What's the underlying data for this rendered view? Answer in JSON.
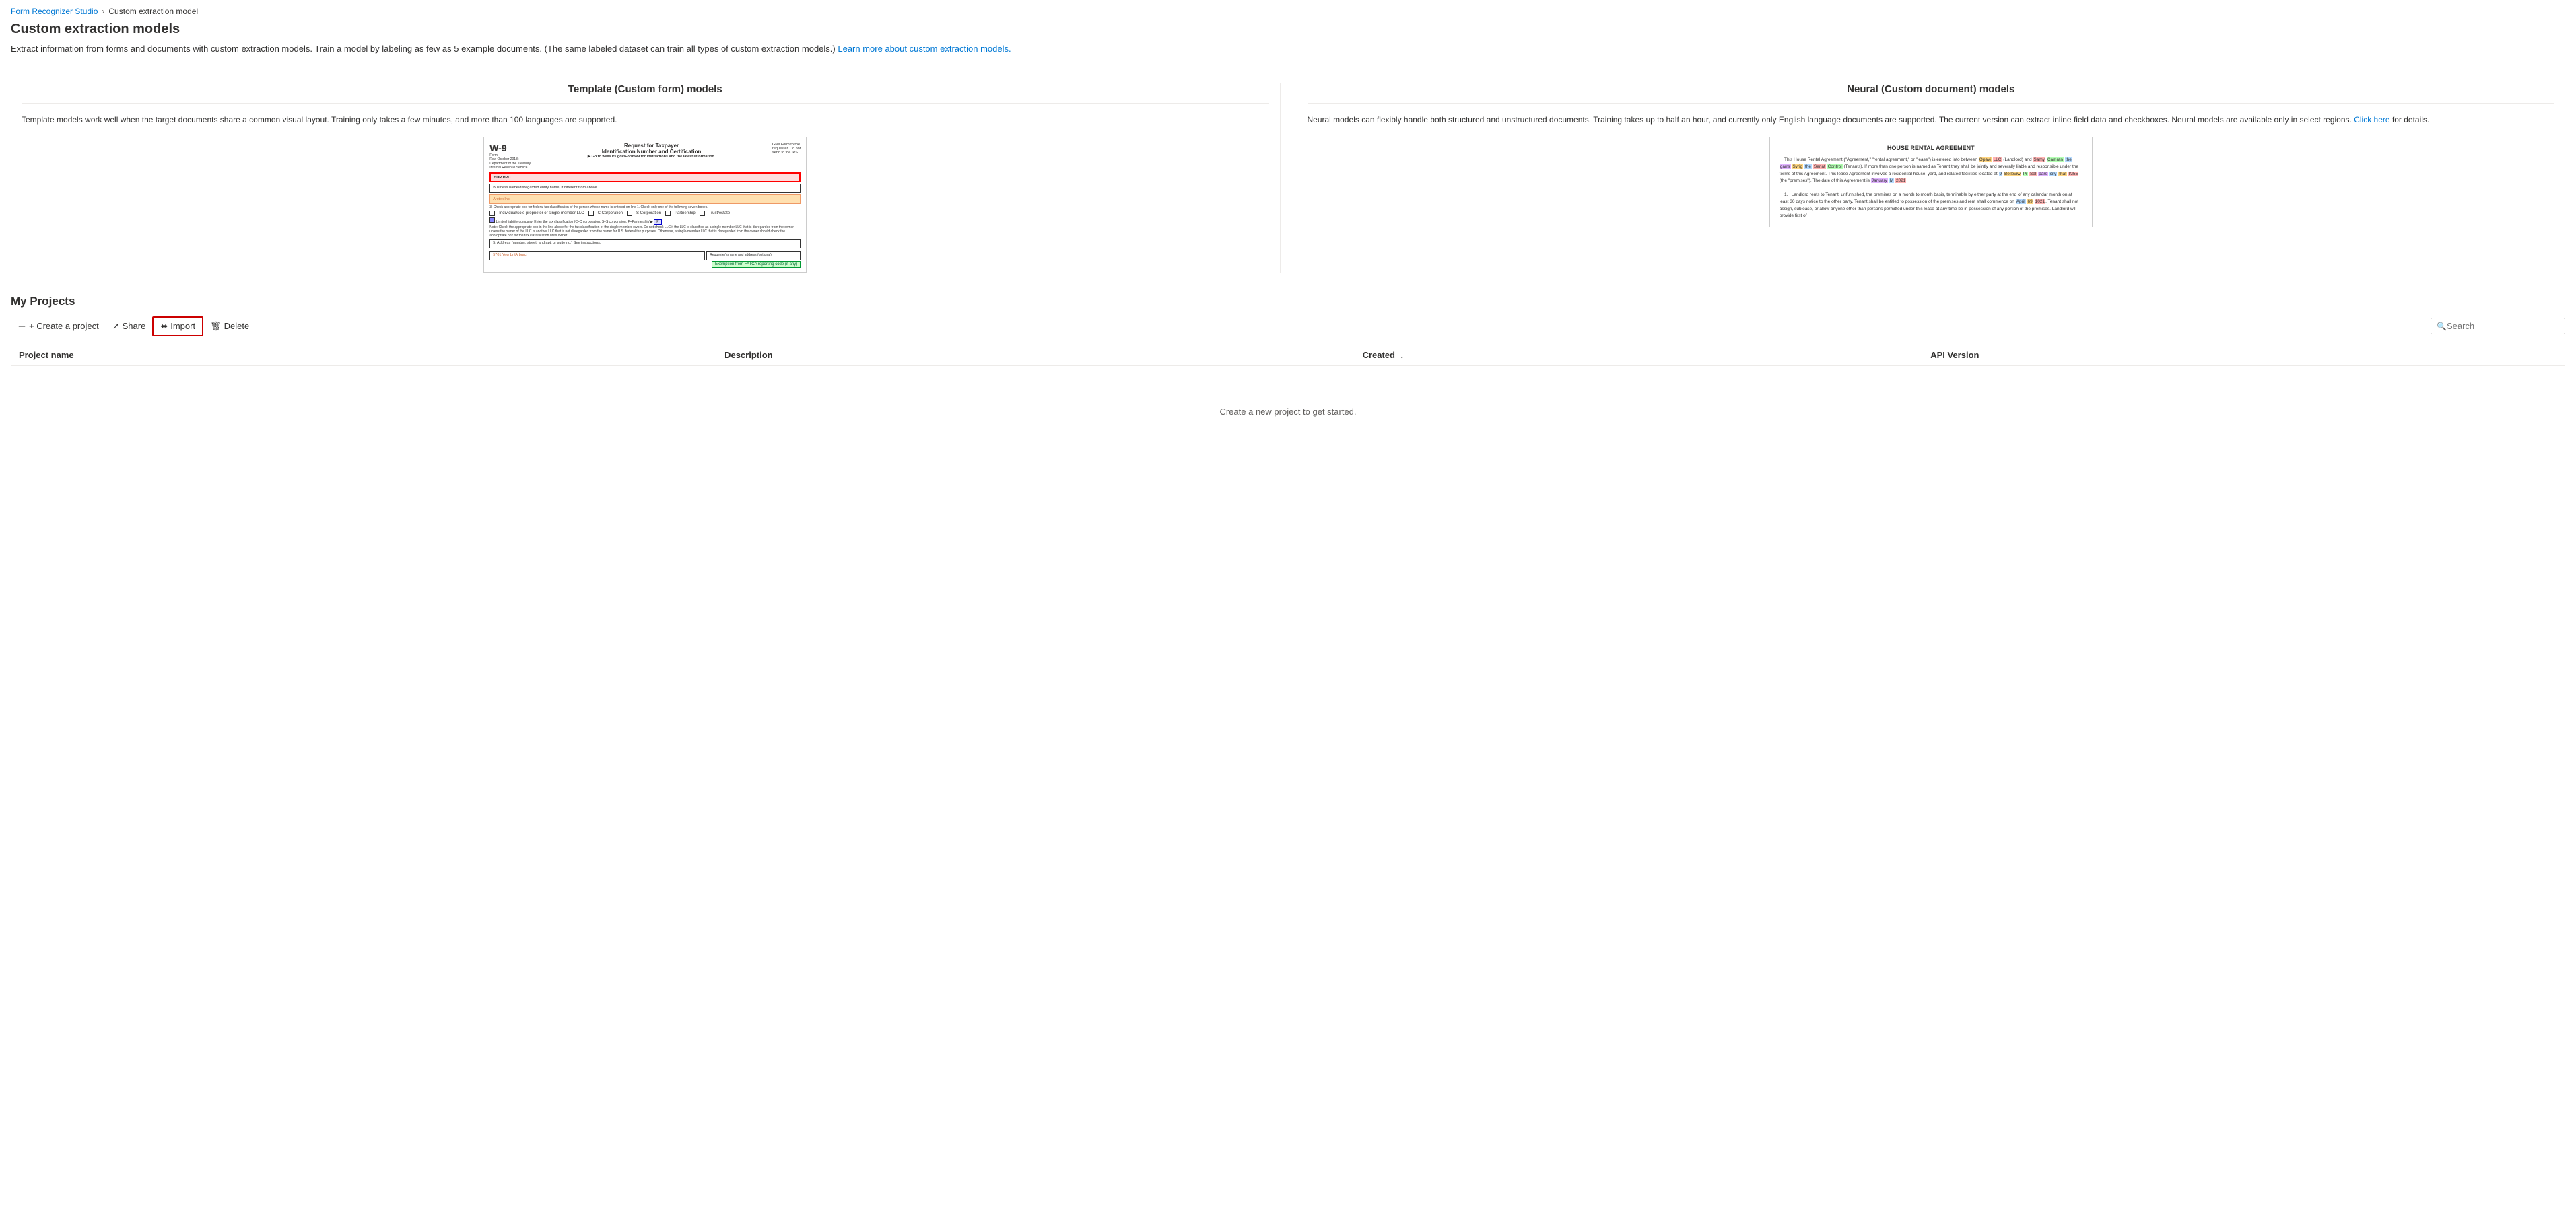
{
  "breadcrumb": {
    "home_label": "Form Recognizer Studio",
    "current_label": "Custom extraction model"
  },
  "page": {
    "title": "Custom extraction models",
    "description": "Extract information from forms and documents with custom extraction models. Train a model by labeling as few as 5 example documents. (The same labeled dataset can train all types of custom extraction models.)",
    "description_link_text": "Learn more about custom extraction models.",
    "description_link_url": "#"
  },
  "model_types": {
    "template": {
      "title": "Template (Custom form) models",
      "description": "Template models work well when the target documents share a common visual layout. Training only takes a few minutes, and more than 100 languages are supported."
    },
    "neural": {
      "title": "Neural (Custom document) models",
      "description": "Neural models can flexibly handle both structured and unstructured documents. Training takes up to half an hour, and currently only English language documents are supported. The current version can extract inline field data and checkboxes. Neural models are available only in select regions.",
      "click_here_text": "Click here",
      "for_details_text": "for details."
    }
  },
  "projects": {
    "section_title": "My Projects",
    "toolbar": {
      "create_label": "+ Create a project",
      "share_label": "Share",
      "import_label": "Import",
      "delete_label": "Delete"
    },
    "search_placeholder": "Search",
    "table": {
      "columns": [
        {
          "key": "name",
          "label": "Project name"
        },
        {
          "key": "description",
          "label": "Description"
        },
        {
          "key": "created",
          "label": "Created",
          "sortable": true,
          "sort_dir": "desc"
        },
        {
          "key": "api_version",
          "label": "API Version"
        }
      ],
      "rows": [],
      "empty_message": "Create a new project to get started."
    }
  }
}
